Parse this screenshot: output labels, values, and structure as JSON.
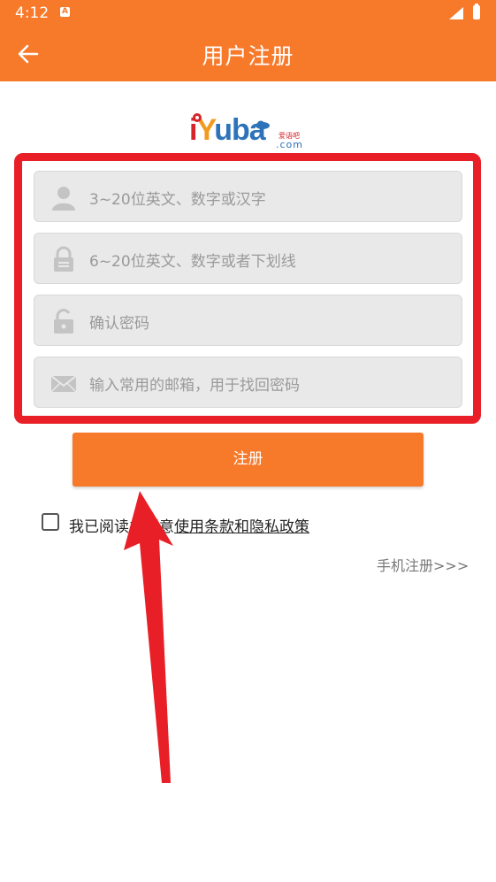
{
  "status_bar": {
    "time": "4:12",
    "notification_icon": "a-icon"
  },
  "app_bar": {
    "title": "用户注册",
    "back_icon": "arrow-left-icon"
  },
  "logo": {
    "text_i": "i",
    "text_y": "Y",
    "text_uba": "uba",
    "cn": "爱语吧",
    "com": ".com"
  },
  "form": {
    "username_placeholder": "3~20位英文、数字或汉字",
    "password_placeholder": "6~20位英文、数字或者下划线",
    "confirm_placeholder": "确认密码",
    "email_placeholder": "输入常用的邮箱，用于找回密码"
  },
  "register_button": "注册",
  "agreement": {
    "prefix": "我已阅读并同意",
    "link": "使用条款和隐私政策",
    "checked": false
  },
  "phone_register_link": "手机注册>>>",
  "colors": {
    "accent": "#f7792a",
    "highlight": "#e81f26"
  }
}
